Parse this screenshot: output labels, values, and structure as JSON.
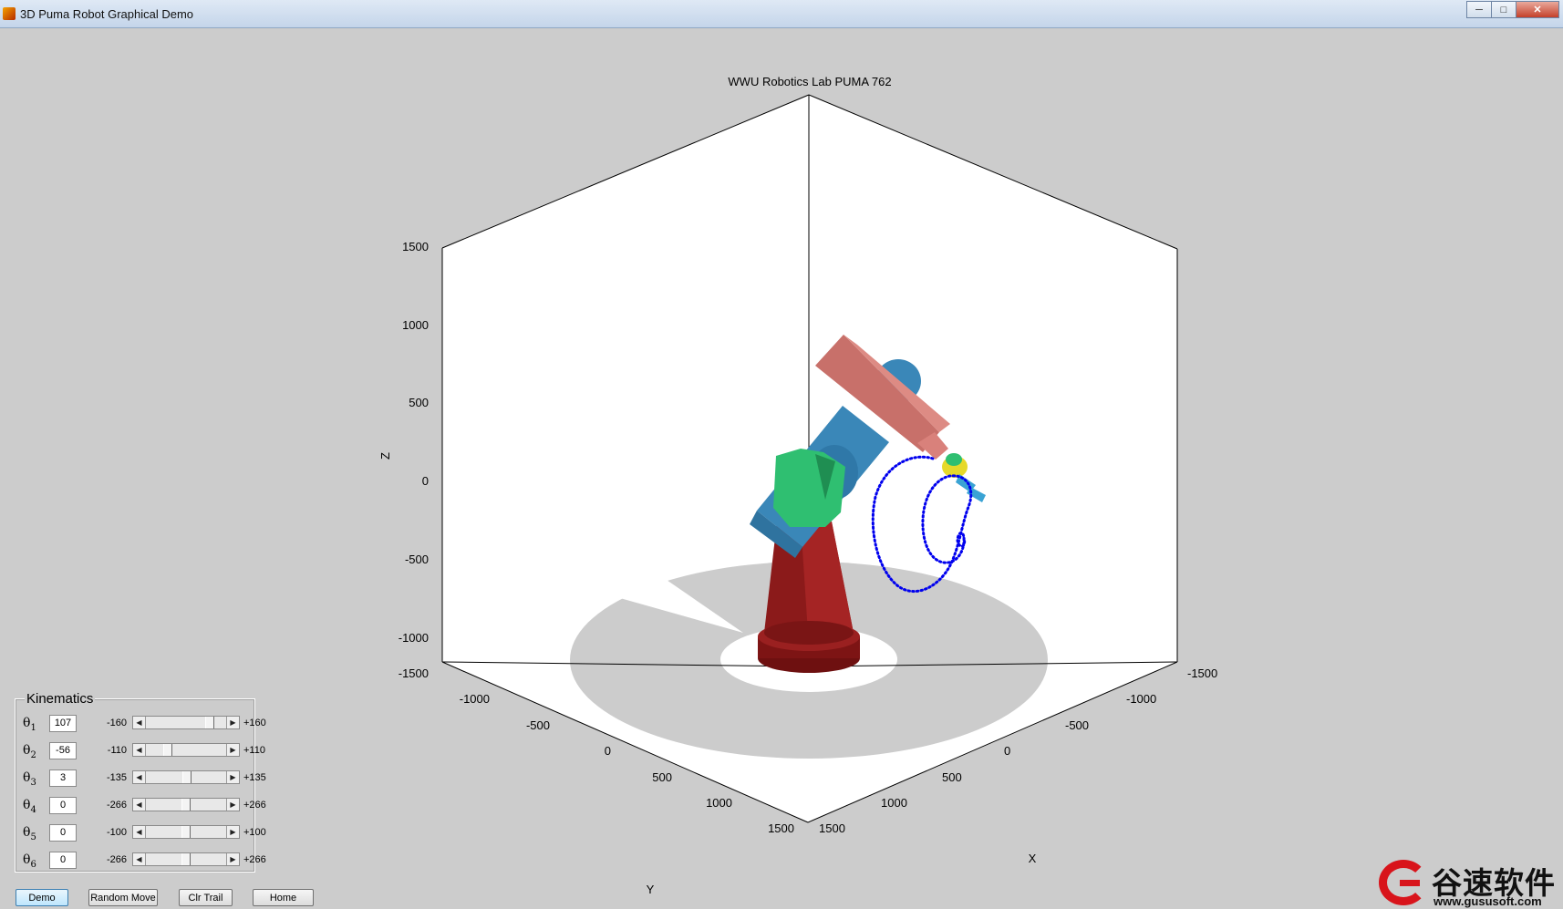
{
  "window": {
    "title": "3D Puma Robot Graphical Demo"
  },
  "plot": {
    "title": "WWU Robotics Lab PUMA 762",
    "xlabel": "X",
    "ylabel": "Y",
    "zlabel": "Z",
    "z_ticks": [
      "1500",
      "1000",
      "500",
      "0",
      "-500",
      "-1000"
    ],
    "y_ticks": [
      "-1500",
      "-1000",
      "-500",
      "0",
      "500",
      "1000",
      "1500"
    ],
    "x_ticks": [
      "-1500",
      "-1000",
      "-500",
      "0",
      "500",
      "1000",
      "1500"
    ],
    "colors": {
      "base": "#8b1a1a",
      "link_blue": "#3a87b8",
      "shoulder": "#2fbf71",
      "forearm": "#c8706a",
      "wrist": "#e6d92a",
      "trail": "#0000ee"
    }
  },
  "kinematics": {
    "title": "Kinematics",
    "rows": [
      {
        "sym": "θ",
        "sub": "1",
        "value": "107",
        "min": "-160",
        "max": "+160",
        "pos": 0.83
      },
      {
        "sym": "θ",
        "sub": "2",
        "value": "-56",
        "min": "-110",
        "max": "+110",
        "pos": 0.25
      },
      {
        "sym": "θ",
        "sub": "3",
        "value": "3",
        "min": "-135",
        "max": "+135",
        "pos": 0.51
      },
      {
        "sym": "θ",
        "sub": "4",
        "value": "0",
        "min": "-266",
        "max": "+266",
        "pos": 0.5
      },
      {
        "sym": "θ",
        "sub": "5",
        "value": "0",
        "min": "-100",
        "max": "+100",
        "pos": 0.5
      },
      {
        "sym": "θ",
        "sub": "6",
        "value": "0",
        "min": "-266",
        "max": "+266",
        "pos": 0.5
      }
    ]
  },
  "buttons": {
    "demo": "Demo",
    "random": "Random Move",
    "clr": "Clr Trail",
    "home": "Home"
  },
  "watermark": {
    "cn": "谷速软件",
    "url": "www.gususoft.com"
  }
}
